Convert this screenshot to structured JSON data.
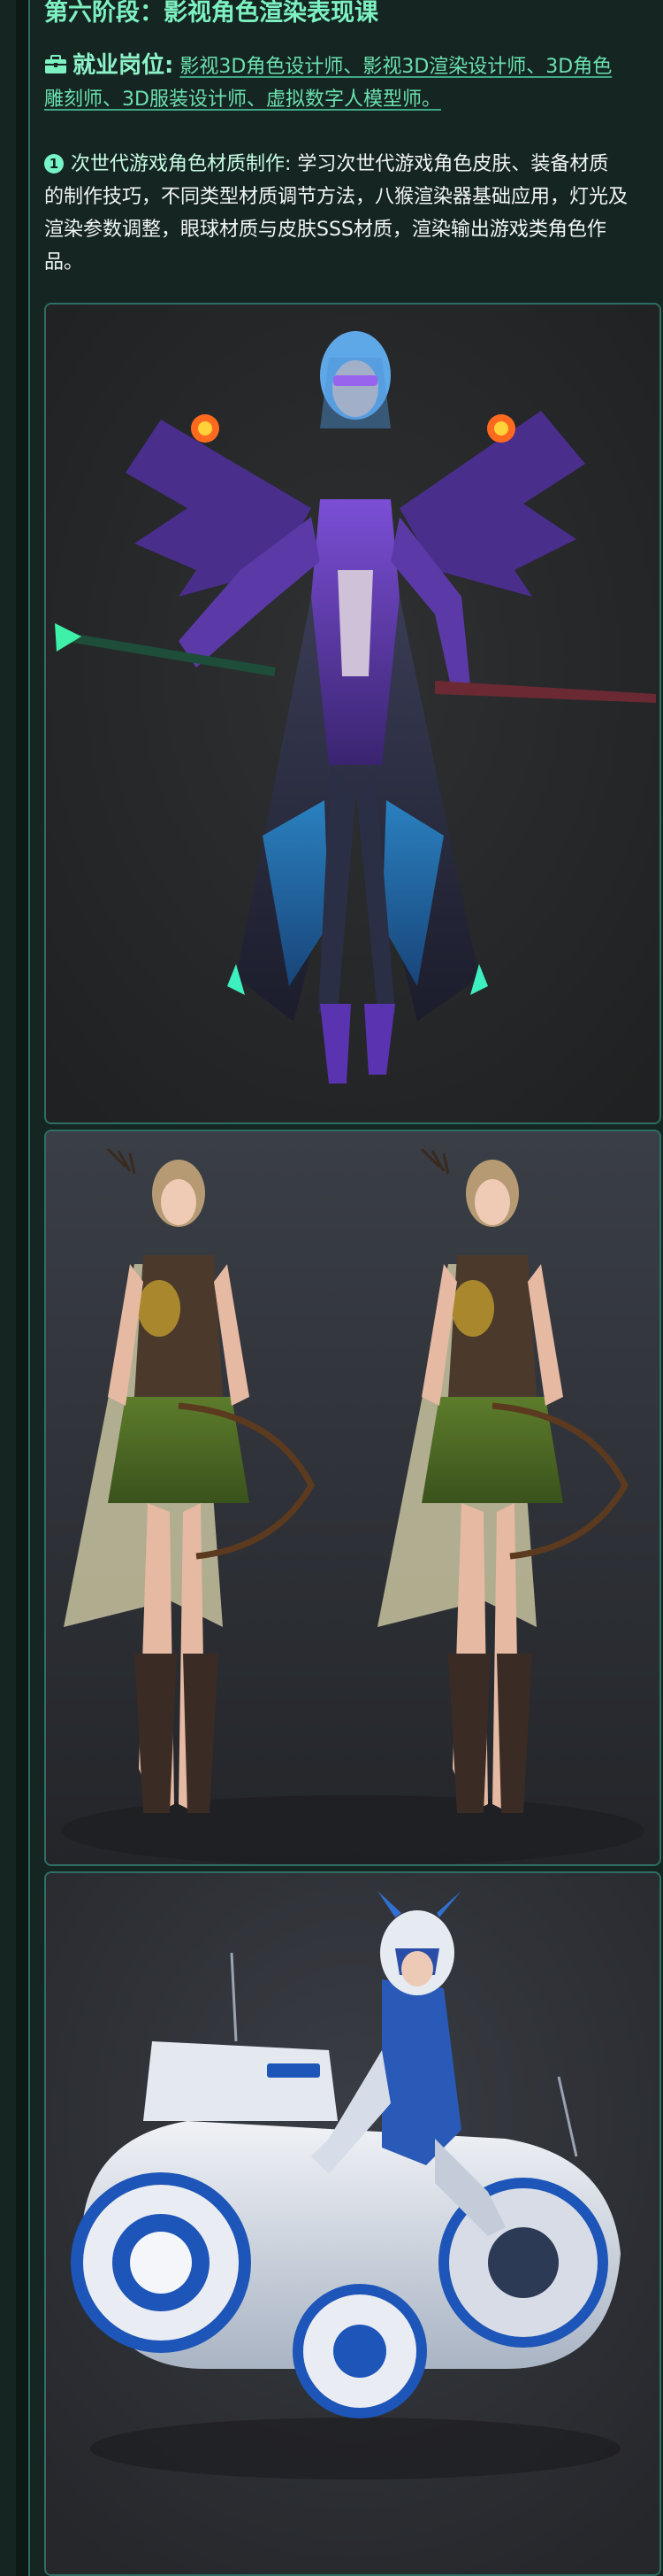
{
  "stage": {
    "title": "第六阶段：影视角色渲染表现课"
  },
  "jobs": {
    "icon": "briefcase-icon",
    "label": "就业岗位:",
    "list": "影视3D角色设计师、影视3D渲染设计师、3D角色雕刻师、3D服装设计师、虚拟数字人模型师。"
  },
  "intro": {
    "number": "1",
    "topic": "次世代游戏角色材质制作:",
    "text": "学习次世代游戏角色皮肤、装备材质的制作技巧，不同类型材质调节方法，八猴渲染器基础应用，灯光及渲染参数调整，眼球材质与皮肤SSS材质，渲染输出游戏类角色作品。"
  },
  "colors": {
    "background": "#142522",
    "accent": "#7ef1c2",
    "text": "#f2f5f3",
    "panel_border": "#2f6f63"
  },
  "images": [
    {
      "name": "cyber-armor-heroine-render"
    },
    {
      "name": "archer-girl-front-renders"
    },
    {
      "name": "police-motorbike-rider-render"
    }
  ]
}
